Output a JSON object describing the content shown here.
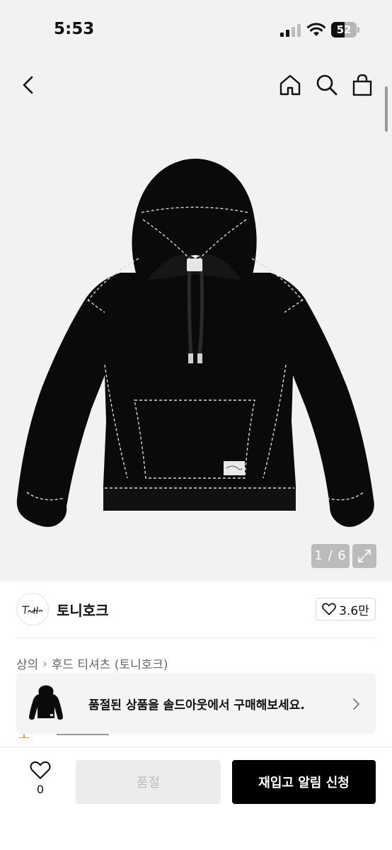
{
  "status_bar": {
    "time": "5:53",
    "battery_level": "52",
    "battery_fraction": 0.52
  },
  "nav": {
    "back_icon": "chevron-left-icon",
    "home_icon": "home-icon",
    "search_icon": "search-icon",
    "bag_icon": "shopping-bag-icon"
  },
  "gallery": {
    "pager": "1 / 6",
    "expand_icon": "expand-icon"
  },
  "brand": {
    "name": "토니호크",
    "like_count": "3.6만",
    "logo_text": "Tony Hawk"
  },
  "breadcrumb": {
    "items": [
      "상의",
      "후드 티셔츠 (토니호크)"
    ]
  },
  "soldout_banner": {
    "text": "품절된 상품을 솔드아웃에서 구매해보세요."
  },
  "bottom": {
    "wish_count": "0",
    "soldout_label": "품절",
    "restock_label": "재입고 알림 신청"
  },
  "colors": {
    "accent": "#000000",
    "disabled_bg": "#ececec",
    "disabled_text": "#bdbdbd",
    "hero_bg": "#f2f2f2"
  }
}
